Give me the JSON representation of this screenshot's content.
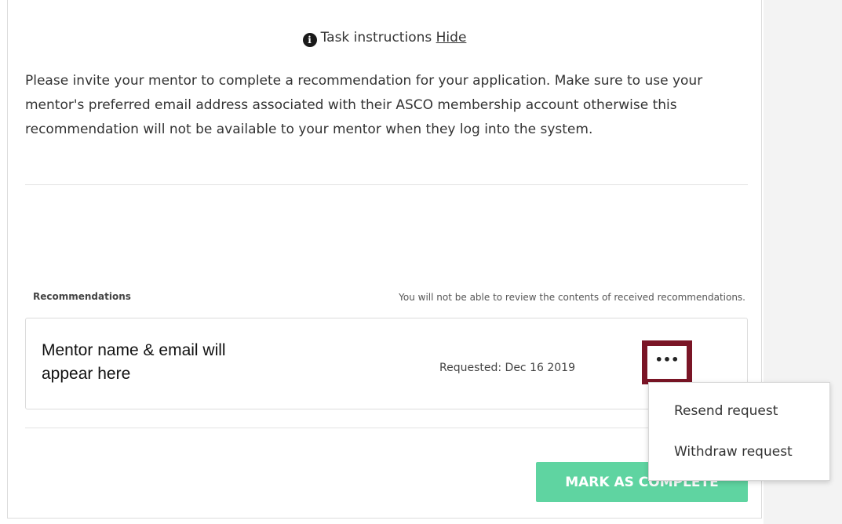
{
  "instructions": {
    "header": "Task instructions",
    "hide_label": "Hide",
    "icon": "info-icon",
    "body": "Please invite your mentor to complete a recommendation for your application. Make sure to use your mentor's preferred email address associated with their ASCO membership account otherwise this recommendation will not be available to your mentor when they log into the system."
  },
  "recommendations": {
    "label": "Recommendations",
    "note": "You will not be able to review the contents of received recommendations.",
    "items": [
      {
        "mentor": "Mentor name & email will appear here",
        "requested": "Requested: Dec 16 2019",
        "menu_icon": "•••"
      }
    ]
  },
  "menu": {
    "items": [
      "Resend request",
      "Withdraw request"
    ]
  },
  "actions": {
    "complete_label": "MARK AS COMPLETE"
  },
  "colors": {
    "accent_green": "#5fd4a1",
    "highlight": "#7a1526"
  }
}
